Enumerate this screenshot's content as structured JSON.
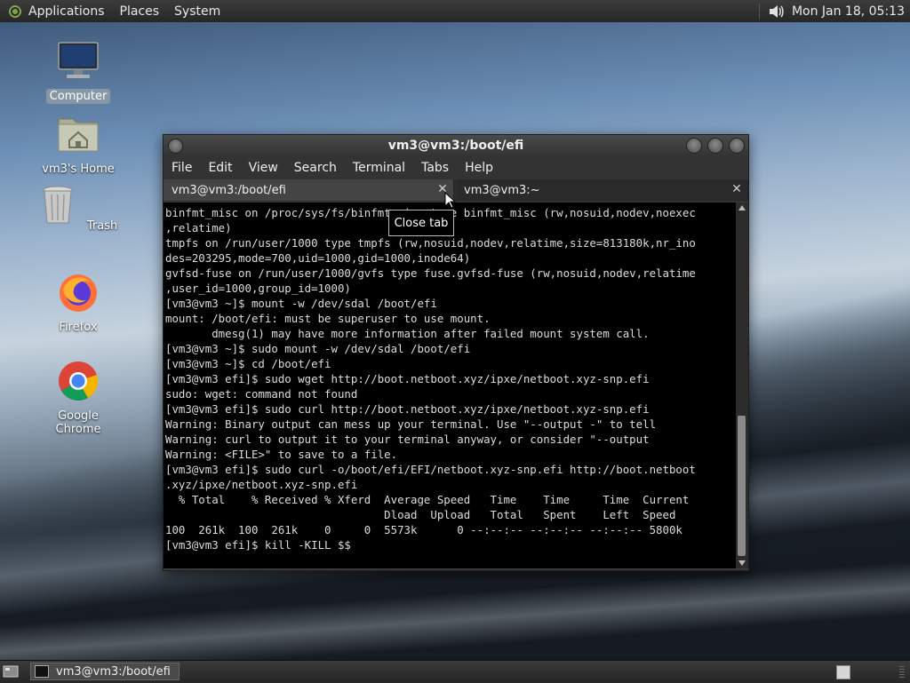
{
  "top_panel": {
    "menus": [
      "Applications",
      "Places",
      "System"
    ],
    "clock": "Mon Jan 18, 05:13",
    "icons": {
      "logo": "mate-logo-icon",
      "volume": "speaker-icon"
    }
  },
  "desktop": {
    "icons": [
      {
        "label": "Computer",
        "icon": "computer-icon",
        "selected": true
      },
      {
        "label": "vm3's Home",
        "icon": "home-folder-icon",
        "selected": false
      },
      {
        "label": "Trash",
        "icon": "trash-icon",
        "selected": false
      },
      {
        "label": "Firefox",
        "icon": "firefox-icon",
        "selected": false
      },
      {
        "label": "Google Chrome",
        "icon": "chrome-icon",
        "selected": false
      }
    ]
  },
  "window": {
    "title": "vm3@vm3:/boot/efi",
    "menu": [
      "File",
      "Edit",
      "View",
      "Search",
      "Terminal",
      "Tabs",
      "Help"
    ],
    "tabs": [
      {
        "label": "vm3@vm3:/boot/efi",
        "active": true
      },
      {
        "label": "vm3@vm3:~",
        "active": false
      }
    ],
    "tooltip": "Close tab",
    "lines": [
      "binfmt_misc on /proc/sys/fs/binfmt_misc type binfmt_misc (rw,nosuid,nodev,noexec",
      ",relatime)",
      "tmpfs on /run/user/1000 type tmpfs (rw,nosuid,nodev,relatime,size=813180k,nr_ino",
      "des=203295,mode=700,uid=1000,gid=1000,inode64)",
      "gvfsd-fuse on /run/user/1000/gvfs type fuse.gvfsd-fuse (rw,nosuid,nodev,relatime",
      ",user_id=1000,group_id=1000)",
      "[vm3@vm3 ~]$ mount -w /dev/sdal /boot/efi",
      "mount: /boot/efi: must be superuser to use mount.",
      "       dmesg(1) may have more information after failed mount system call.",
      "[vm3@vm3 ~]$ sudo mount -w /dev/sdal /boot/efi",
      "[vm3@vm3 ~]$ cd /boot/efi",
      "[vm3@vm3 efi]$ sudo wget http://boot.netboot.xyz/ipxe/netboot.xyz-snp.efi",
      "sudo: wget: command not found",
      "[vm3@vm3 efi]$ sudo curl http://boot.netboot.xyz/ipxe/netboot.xyz-snp.efi",
      "Warning: Binary output can mess up your terminal. Use \"--output -\" to tell",
      "Warning: curl to output it to your terminal anyway, or consider \"--output",
      "Warning: <FILE>\" to save to a file.",
      "[vm3@vm3 efi]$ sudo curl -o/boot/efi/EFI/netboot.xyz-snp.efi http://boot.netboot",
      ".xyz/ipxe/netboot.xyz-snp.efi",
      "  % Total    % Received % Xferd  Average Speed   Time    Time     Time  Current",
      "                                 Dload  Upload   Total   Spent    Left  Speed",
      "100  261k  100  261k    0     0  5573k      0 --:--:-- --:--:-- --:--:-- 5800k",
      "[vm3@vm3 efi]$ kill -KILL $$"
    ]
  },
  "taskbar": {
    "task_label": "vm3@vm3:/boot/efi",
    "icons": {
      "show_desktop": "show-desktop-icon",
      "task": "terminal-icon",
      "workspace": "workspace-icon"
    }
  }
}
